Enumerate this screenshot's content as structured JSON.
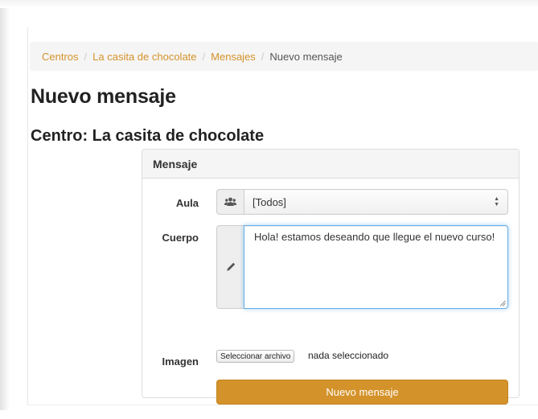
{
  "breadcrumb": {
    "items": [
      "Centros",
      "La casita de chocolate",
      "Mensajes"
    ],
    "separator": "/",
    "active": "Nuevo mensaje"
  },
  "page": {
    "title": "Nuevo mensaje",
    "center_heading": "Centro: La casita de chocolate"
  },
  "panel": {
    "heading": "Mensaje"
  },
  "form": {
    "aula": {
      "label": "Aula",
      "selected": "[Todos]",
      "icon": "users-icon"
    },
    "cuerpo": {
      "label": "Cuerpo",
      "value": "Hola! estamos deseando que llegue el nuevo curso!",
      "icon": "pencil-icon"
    },
    "imagen": {
      "label": "Imagen",
      "button_label": "Seleccionar archivo",
      "status": "nada seleccionado"
    },
    "submit_label": "Nuevo mensaje"
  },
  "colors": {
    "accent": "#d4922a",
    "focus": "#66afe9"
  }
}
